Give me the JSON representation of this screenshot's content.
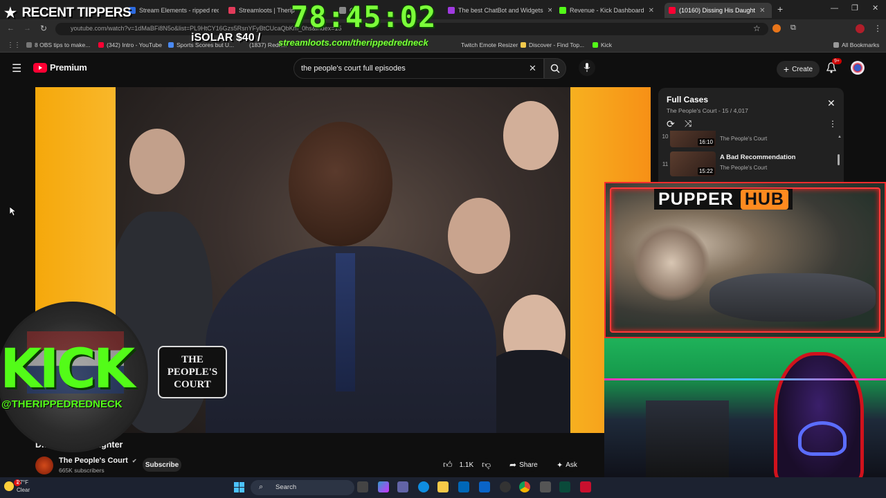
{
  "tabs": [
    {
      "label": "Stream Elements - ripped redne"
    },
    {
      "label": "Streamloots | Theripp"
    },
    {
      "label": "Ord"
    },
    {
      "label": "The best ChatBot and Widgets"
    },
    {
      "label": "Revenue - Kick Dashboard"
    },
    {
      "label": "(10160) Dissing His Daught"
    }
  ],
  "address": {
    "url": "youtube.com/watch?v=1dMaBFi8N5o&list=PL9HtCY16Gzs5RsnYFyBtCUcaQbKm_0hs&index=15"
  },
  "bookmarks": [
    {
      "label": "8 OBS tips to make..."
    },
    {
      "label": "(342) Intro - YouTube"
    },
    {
      "label": "Sports Scores but U..."
    },
    {
      "label": "(1837) Redn..."
    },
    {
      "label": "Twitch Emote Resizer"
    },
    {
      "label": "Discover - Find Top..."
    },
    {
      "label": "Kick"
    },
    {
      "label": "All Bookmarks"
    }
  ],
  "overlay": {
    "recent_tippers": "RECENT TIPPERS",
    "timer": "78:45:02",
    "tipper": "iSOLAR $40 /",
    "streamloots": "streamloots.com/therippedredneck",
    "kick_logo": "KICK",
    "kick_handle": "@THERIPPEDREDNECK",
    "pupper": "PUPPER",
    "hub": "HUB"
  },
  "youtube": {
    "brand": "Premium",
    "search_value": "the people's court full episodes",
    "create_label": "Create",
    "notification_count": "9+"
  },
  "video": {
    "logo_text_1": "THE",
    "logo_text_2": "PEOPLE'S",
    "logo_text_3": "COURT",
    "title": "Dissing His Daughter",
    "channel": "The People's Court",
    "subscribers": "665K subscribers",
    "subscribe_label": "Subscribe",
    "likes": "1.1K",
    "share_label": "Share",
    "ask_label": "Ask"
  },
  "playlist": {
    "title": "Full Cases",
    "subtitle": "The People's Court - 15 / 4,017",
    "items": [
      {
        "num": "10",
        "duration": "16:10",
        "title": "",
        "channel": "The People's Court"
      },
      {
        "num": "11",
        "duration": "15:22",
        "title": "A Bad Recommendation",
        "channel": "The People's Court"
      }
    ]
  },
  "taskbar": {
    "temperature": "27°F",
    "condition": "Clear",
    "search_label": "Search",
    "weather_badge": "1"
  },
  "colors": {
    "kick_green": "#53fc18",
    "timer_green": "#7cff3a",
    "youtube_red": "#ff0033",
    "pupper_red": "#ff2d2d",
    "hub_orange": "#ff8a1f"
  }
}
